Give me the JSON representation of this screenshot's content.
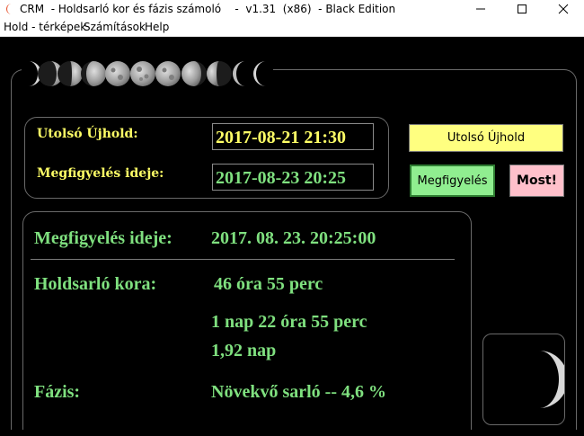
{
  "window": {
    "title": "CRM  - Holdsarló kor és fázis számoló    -  v1.31  (x86)  - Black Edition"
  },
  "menu": [
    "Hold - térképek",
    "Számítások",
    "Help"
  ],
  "top_panel": {
    "last_newmoon_label": "Utolsó Újhold:",
    "last_newmoon_value": "2017-08-21 21:30",
    "observation_label": "Megfigyelés ideje:",
    "observation_value": "2017-08-23 20:25"
  },
  "buttons": {
    "last_newmoon": "Utolsó Újhold",
    "observation": "Megfigyelés",
    "now": "Most!"
  },
  "results": {
    "observation_label": "Megfigyelés ideje:",
    "observation_value": "2017. 08. 23. 20:25:00",
    "age_label": "Holdsarló kora:",
    "age_hours": "46 óra 55 perc",
    "age_days_hours": "1 nap  22 óra 55 perc",
    "age_days": "1,92 nap",
    "phase_label": "Fázis:",
    "phase_value": "Növekvő sarló  --  4,6 %"
  },
  "colors": {
    "label_yellow": "#ffff66",
    "value_green": "#7fe07f",
    "btn_yellow": "#ffff80",
    "btn_green": "#90ee90",
    "btn_pink": "#ffc0cb"
  }
}
